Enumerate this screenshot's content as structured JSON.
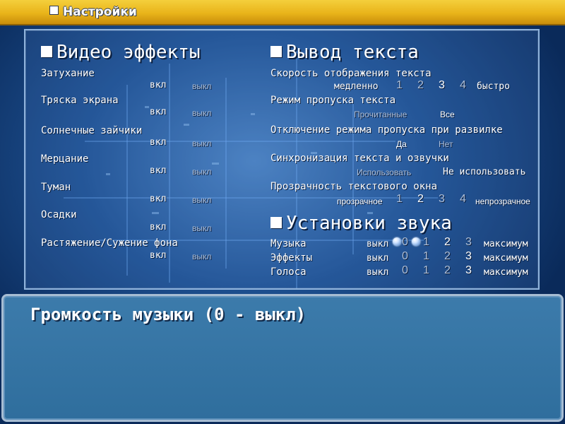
{
  "header": {
    "title": "Настройки"
  },
  "video": {
    "title": "Видео эффекты",
    "on_label": "вкл",
    "off_label": "выкл",
    "items": [
      {
        "label": "Затухание"
      },
      {
        "label": "Тряска экрана"
      },
      {
        "label": "Солнечные зайчики"
      },
      {
        "label": "Мерцание"
      },
      {
        "label": "Туман"
      },
      {
        "label": "Осадки"
      },
      {
        "label": "Растяжение/Сужение фона"
      }
    ]
  },
  "text_output": {
    "title": "Вывод текста",
    "speed": {
      "label": "Скорость отображения текста",
      "slow": "медленно",
      "fast": "быстро",
      "levels": [
        "1",
        "2",
        "3",
        "4"
      ]
    },
    "skip_mode": {
      "label": "Режим пропуска текста",
      "read": "Прочитанные",
      "all": "Все"
    },
    "skip_off": {
      "label": "Отключение режима пропуска при развилке",
      "yes": "Да",
      "no": "Нет"
    },
    "sync": {
      "label": "Синхронизация текста и озвучки",
      "use": "Использовать",
      "dont_use": "Не использовать"
    },
    "opacity": {
      "label": "Прозрачность текстового окна",
      "transparent": "прозрачное",
      "opaque": "непрозрачное",
      "levels": [
        "1",
        "2",
        "3",
        "4"
      ]
    }
  },
  "sound": {
    "title": "Установки звука",
    "off_label": "выкл",
    "max_label": "максимум",
    "levels": [
      "0",
      "1",
      "2",
      "3"
    ],
    "rows": [
      {
        "label": "Музыка"
      },
      {
        "label": "Эффекты"
      },
      {
        "label": "Голоса"
      }
    ]
  },
  "message": {
    "text": "Громкость музыки (0 - выкл)"
  }
}
